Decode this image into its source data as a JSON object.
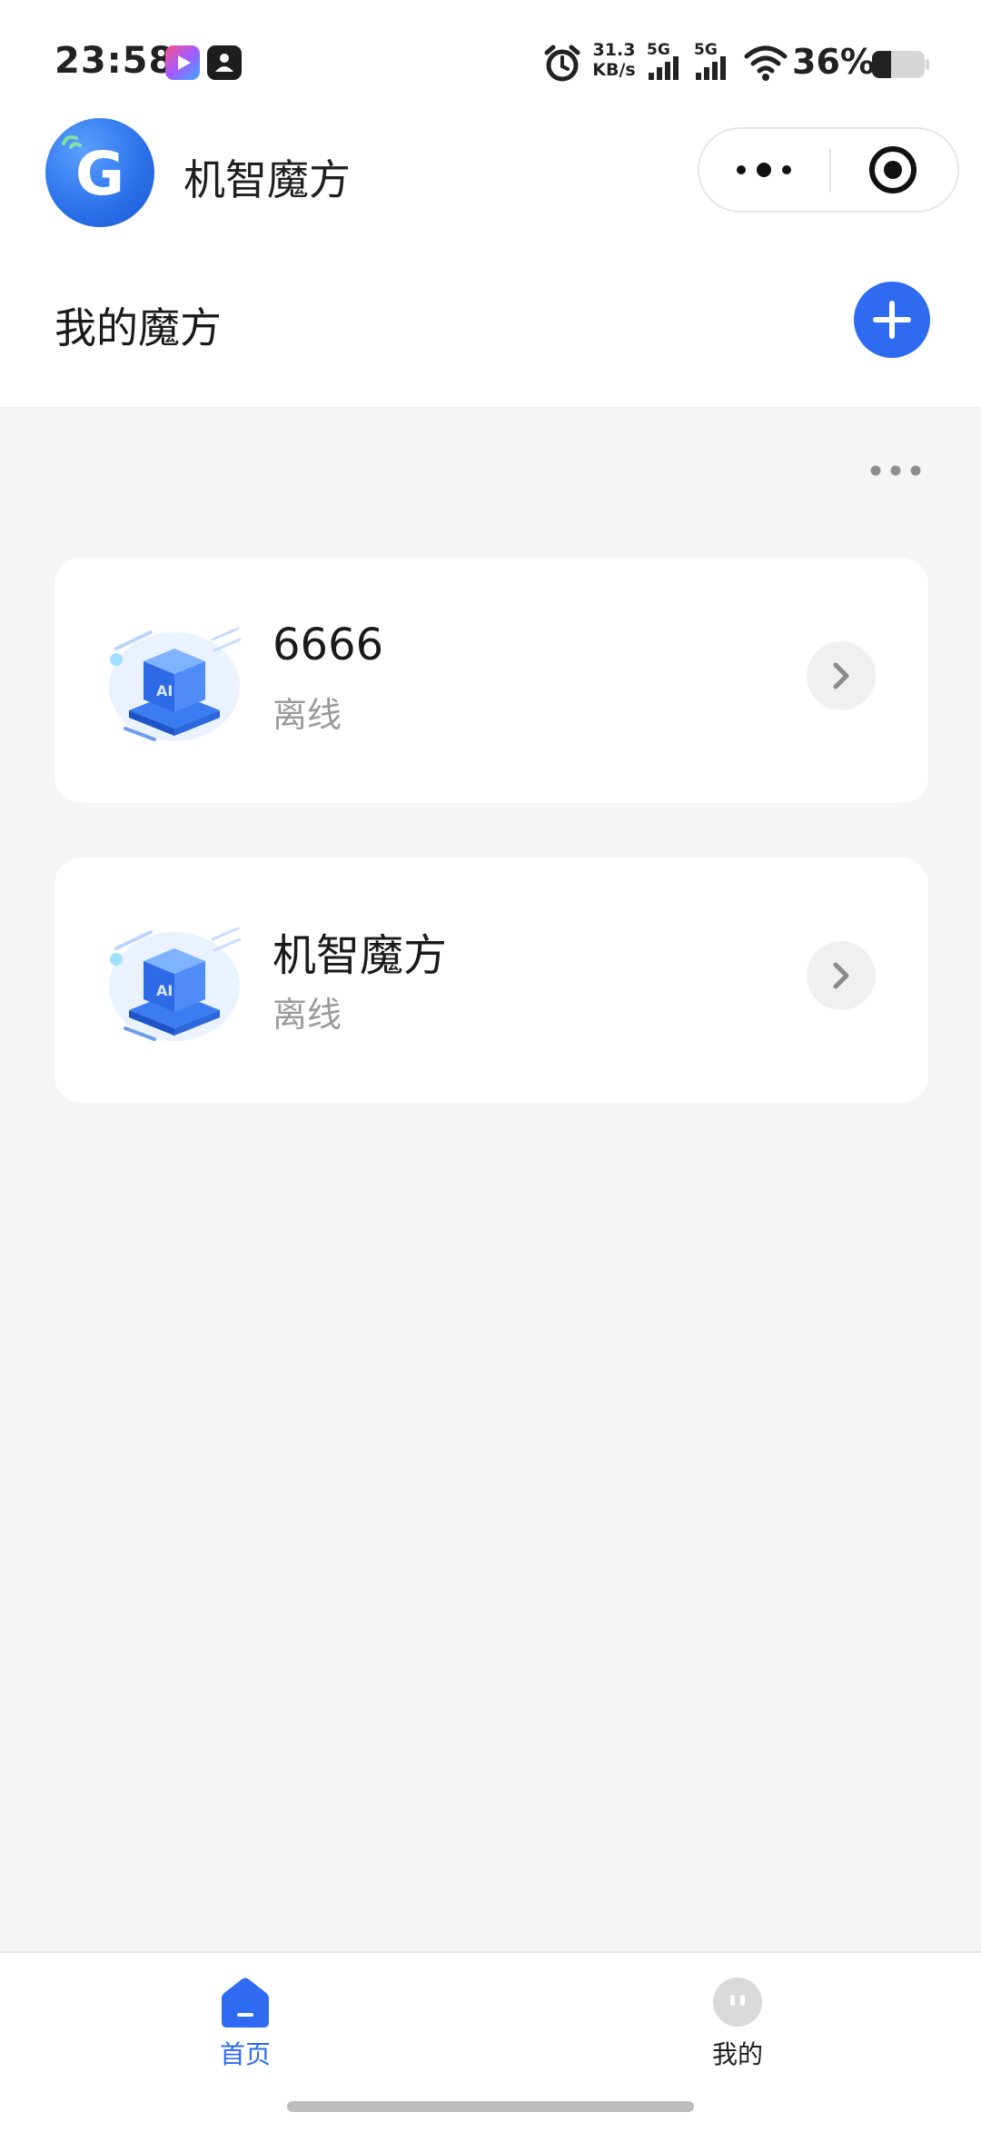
{
  "status_bar": {
    "time": "23:58",
    "net_speed_value": "31.3",
    "net_speed_unit": "KB/s",
    "signal_1_label": "5G",
    "signal_2_label": "5G",
    "battery_percent": "36%"
  },
  "header": {
    "app_name": "机智魔方",
    "logo_letter": "G"
  },
  "section": {
    "title": "我的魔方"
  },
  "devices": [
    {
      "name": "6666",
      "status": "离线",
      "image_label": "AI"
    },
    {
      "name": "机智魔方",
      "status": "离线",
      "image_label": "AI"
    }
  ],
  "tab_bar": {
    "tabs": [
      {
        "label": "首页",
        "active": true,
        "icon": "home-icon"
      },
      {
        "label": "我的",
        "active": false,
        "icon": "profile-icon"
      }
    ]
  },
  "colors": {
    "accent": "#2e6bf0",
    "page_background": "#f5f5f5",
    "status_offline": "#9a9a9a"
  }
}
